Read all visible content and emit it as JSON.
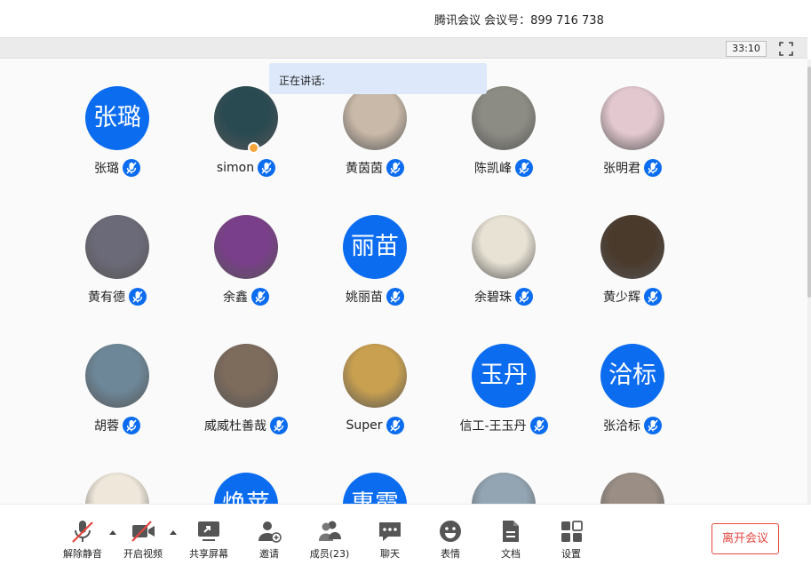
{
  "window": {
    "title": "腾讯会议  会议号：899 716 738"
  },
  "status_bar": {
    "timer": "33:10"
  },
  "speaking": {
    "label": "正在讲话:"
  },
  "participants": [
    {
      "name": "张璐",
      "avatar_text": "张璐",
      "avatar_type": "text"
    },
    {
      "name": "simon",
      "avatar_type": "photo",
      "avatar_color": "#2a4a52",
      "host_badge": true
    },
    {
      "name": "黄茵茵",
      "avatar_type": "photo",
      "avatar_color": "#c9b9a8"
    },
    {
      "name": "陈凯峰",
      "avatar_type": "photo",
      "avatar_color": "#8d8c84"
    },
    {
      "name": "张明君",
      "avatar_type": "photo",
      "avatar_color": "#e3c8cf"
    },
    {
      "name": "黄有德",
      "avatar_type": "photo",
      "avatar_color": "#6b6a78"
    },
    {
      "name": "余鑫",
      "avatar_type": "photo",
      "avatar_color": "#7a3f8a"
    },
    {
      "name": "姚丽苗",
      "avatar_text": "丽苗",
      "avatar_type": "text"
    },
    {
      "name": "余碧珠",
      "avatar_type": "photo",
      "avatar_color": "#e8e2d4"
    },
    {
      "name": "黄少辉",
      "avatar_type": "photo",
      "avatar_color": "#4a3a2c"
    },
    {
      "name": "胡蓉",
      "avatar_type": "photo",
      "avatar_color": "#6d8798"
    },
    {
      "name": "威威杜善哉",
      "avatar_type": "photo",
      "avatar_color": "#7d6b5c"
    },
    {
      "name": "Super",
      "avatar_type": "photo",
      "avatar_color": "#c9a050"
    },
    {
      "name": "信工-王玉丹",
      "avatar_text": "玉丹",
      "avatar_type": "text"
    },
    {
      "name": "张洽标",
      "avatar_text": "洽标",
      "avatar_type": "text"
    },
    {
      "name": "",
      "avatar_type": "photo",
      "avatar_color": "#efe7da"
    },
    {
      "name": "",
      "avatar_text": "焕苹",
      "avatar_type": "text"
    },
    {
      "name": "",
      "avatar_text": "惠霞",
      "avatar_type": "text"
    },
    {
      "name": "",
      "avatar_type": "photo",
      "avatar_color": "#93a5b3"
    },
    {
      "name": "",
      "avatar_type": "photo",
      "avatar_color": "#9a8e85"
    }
  ],
  "toolbar": {
    "unmute": "解除静音",
    "video": "开启视频",
    "share": "共享屏幕",
    "invite": "邀请",
    "members": "成员(23)",
    "chat": "聊天",
    "emoji": "表情",
    "docs": "文档",
    "settings": "设置",
    "leave": "离开会议"
  },
  "colors": {
    "accent": "#0b6cf0",
    "danger": "#e5473f",
    "speaking_bg": "#dde9fb"
  },
  "icons": [
    "mic-off-icon",
    "video-off-icon",
    "share-screen-icon",
    "invite-user-icon",
    "members-icon",
    "chat-icon",
    "emoji-icon",
    "document-icon",
    "settings-icon",
    "fullscreen-icon",
    "mic-icon"
  ]
}
